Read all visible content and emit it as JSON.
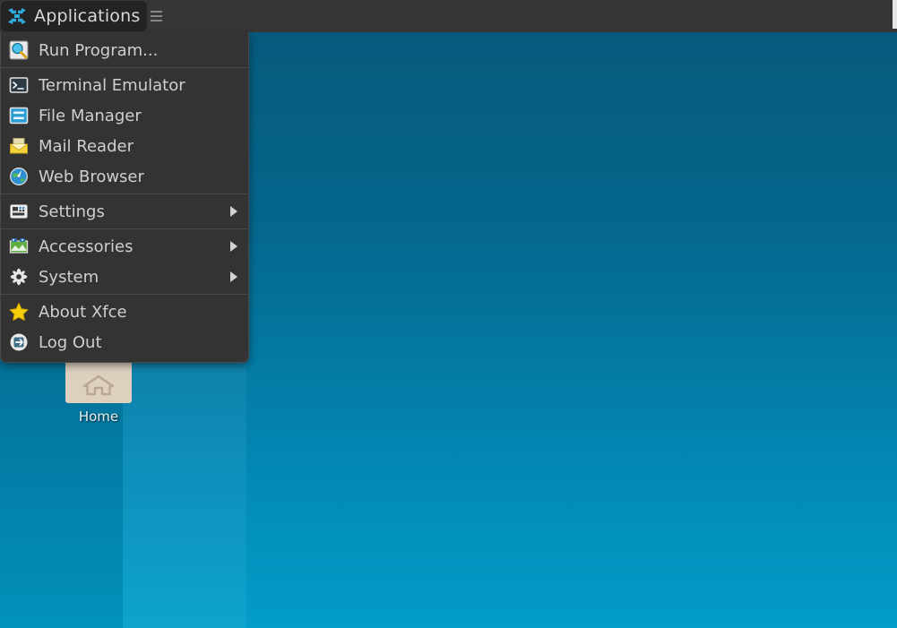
{
  "desktop": {
    "wallpaper_top_color": "#075b7c",
    "wallpaper_bottom_color": "#03a0cc",
    "icons": [
      {
        "id": "home",
        "label": "Home",
        "icon": "folder-home-icon"
      }
    ]
  },
  "panel": {
    "applications_button": {
      "label": "Applications",
      "icon": "xfce-mouse-icon",
      "state": "pressed"
    },
    "handle": {
      "icon": "panel-handle-icon"
    },
    "right_strip": {
      "icon": "panel-edge-strip",
      "color": "#e7e7e7"
    }
  },
  "menu": {
    "name": "applications-menu",
    "background": "#333333",
    "items": [
      {
        "label": "Run Program...",
        "icon": "run-program-icon",
        "submenu": false,
        "separator_after": true
      },
      {
        "label": "Terminal Emulator",
        "icon": "terminal-icon",
        "submenu": false,
        "separator_after": false
      },
      {
        "label": "File Manager",
        "icon": "file-manager-icon",
        "submenu": false,
        "separator_after": false
      },
      {
        "label": "Mail Reader",
        "icon": "mail-icon",
        "submenu": false,
        "separator_after": false
      },
      {
        "label": "Web Browser",
        "icon": "web-browser-icon",
        "submenu": false,
        "separator_after": true
      },
      {
        "label": "Settings",
        "icon": "settings-icon",
        "submenu": true,
        "separator_after": true
      },
      {
        "label": "Accessories",
        "icon": "accessories-icon",
        "submenu": true,
        "separator_after": false
      },
      {
        "label": "System",
        "icon": "system-gear-icon",
        "submenu": true,
        "separator_after": true
      },
      {
        "label": "About Xfce",
        "icon": "star-icon",
        "submenu": false,
        "separator_after": false
      },
      {
        "label": "Log Out",
        "icon": "logout-icon",
        "submenu": false,
        "separator_after": false
      }
    ]
  }
}
